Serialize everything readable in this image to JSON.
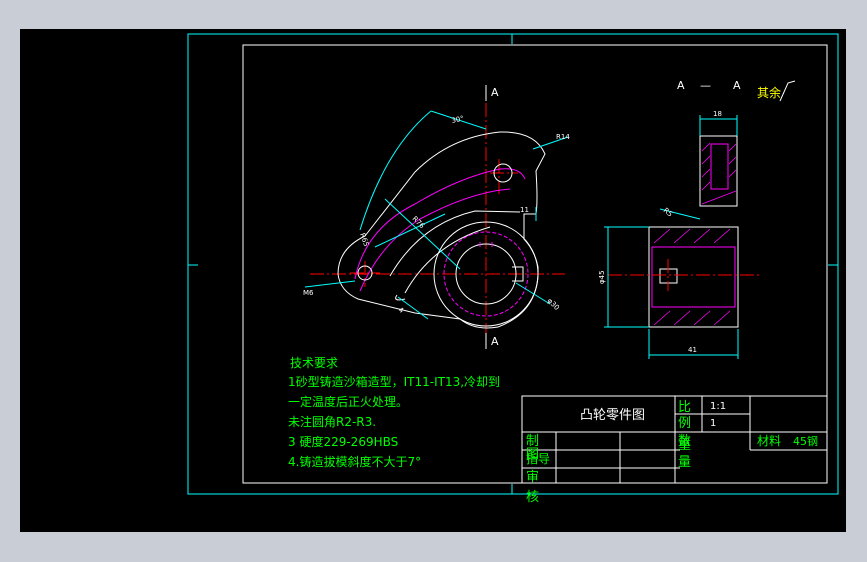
{
  "drawing": {
    "title": "凸轮零件图",
    "section_label_left": "A",
    "section_label_right": "A",
    "section_dash": "—",
    "top_mark": "A",
    "bottom_mark": "A",
    "roughness_note": "其余"
  },
  "dimensions": {
    "angle": "30°",
    "r14": "R14",
    "r76": "R76",
    "r65": "R65",
    "r85": "R85",
    "d11": "11",
    "m6": "M6",
    "phi30": "φ30",
    "d4": "4",
    "d18": "18",
    "d3": "3",
    "phi45": "φ45",
    "w41": "41",
    "r5": "R5"
  },
  "tech_requirements": {
    "heading": "技术要求",
    "item1a": "1砂型铸造沙箱造型，IT11-IT13,冷却到",
    "item1b": "一定温度后正火处理。",
    "item2": "未注圆角R2-R3.",
    "item3": "3 硬度229-269HBS",
    "item4": "4.铸造拔模斜度不大于7°"
  },
  "title_block": {
    "ratio_label": "比",
    "ratio_value": "1:1",
    "qty_label": "例",
    "qty_value": "1",
    "count_label": "数",
    "weight_label": "重",
    "weight_label2": "量",
    "material_label": "材料",
    "material_value": "45钢",
    "drawn_label": "制",
    "drawn_label2": "图",
    "check_label": "指导",
    "review_label": "审",
    "review_label2": "核"
  },
  "colors": {
    "frame": "#00ffff",
    "white": "#ffffff",
    "magenta": "#ff00ff",
    "red": "#ff0000",
    "green": "#00ff00",
    "yellow": "#ffff00"
  }
}
